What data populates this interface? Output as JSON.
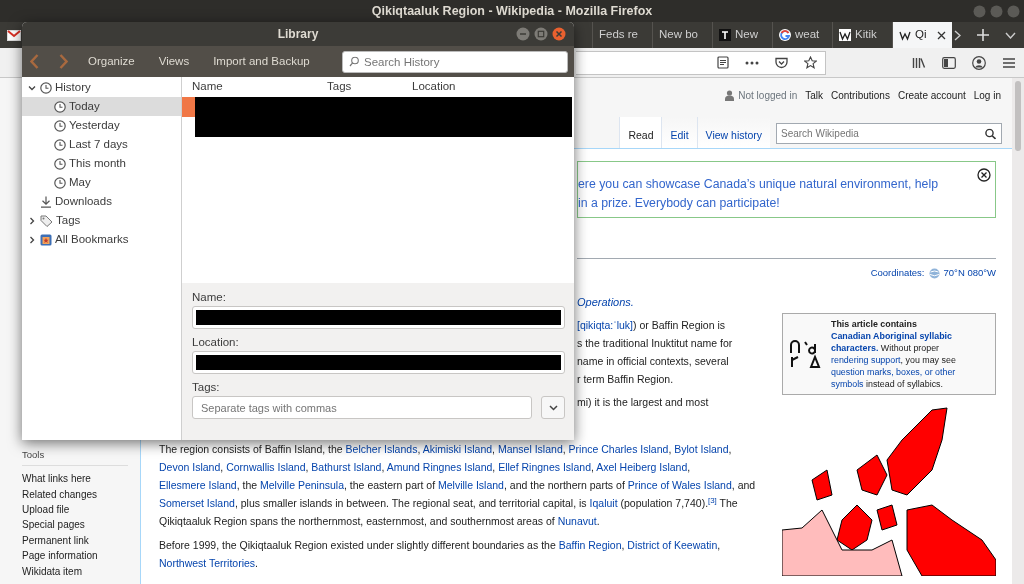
{
  "firefox": {
    "title": "Qikiqtaaluk Region - Wikipedia - Mozilla Firefox",
    "tabs": [
      {
        "label": "Feds re",
        "kind": "none",
        "selected": false
      },
      {
        "label": "New bo",
        "kind": "none",
        "selected": false
      },
      {
        "label": "New",
        "kind": "dark",
        "selected": false
      },
      {
        "label": "weat",
        "kind": "google",
        "selected": false
      },
      {
        "label": "Kitik",
        "kind": "wiki",
        "selected": false
      },
      {
        "label": "Qi",
        "kind": "wiki",
        "selected": true
      }
    ]
  },
  "wiki": {
    "user_links": [
      {
        "text": "Not logged in",
        "kind": "plain"
      },
      {
        "text": "Talk",
        "kind": "link"
      },
      {
        "text": "Contributions",
        "kind": "link"
      },
      {
        "text": "Create account",
        "kind": "link"
      },
      {
        "text": "Log in",
        "kind": "link"
      }
    ],
    "views": [
      {
        "label": "Read",
        "selected": true
      },
      {
        "label": "Edit",
        "selected": false
      },
      {
        "label": "View history",
        "selected": false
      }
    ],
    "search": {
      "placeholder": "Search Wikipedia"
    },
    "banner_lines": [
      "ere you can showcase Canada’s unique natural environment, help",
      "in a prize. Everybody can participate!"
    ],
    "coordinates": {
      "label": "Coordinates:",
      "value": "70°N 080°W"
    },
    "hatnote": "Operations.",
    "intro_lines": [
      [
        {
          "text": "[qikiqta:ˈluk]",
          "kind": "link"
        },
        {
          "text": ") or Baffin Region is",
          "kind": "text"
        }
      ],
      [
        {
          "text": "s the traditional Inuktitut name for",
          "kind": "text"
        }
      ],
      [
        {
          "text": "name in official contexts, several",
          "kind": "text"
        }
      ],
      [
        {
          "text": "r term Baffin Region.",
          "kind": "text"
        }
      ]
    ],
    "second_line": "mi) it is the largest and most",
    "notice": [
      [
        {
          "text": "This article contains",
          "kind": "bold"
        }
      ],
      [
        {
          "text": "Canadian Aboriginal syllabic",
          "kind": "bold-link"
        }
      ],
      [
        {
          "text": "characters.",
          "kind": "bold-link"
        },
        {
          "text": " Without proper",
          "kind": "text"
        }
      ],
      [
        {
          "text": "rendering support",
          "kind": "link"
        },
        {
          "text": ", you may see",
          "kind": "text"
        }
      ],
      [
        {
          "text": "question marks, boxes, or other",
          "kind": "link"
        }
      ],
      [
        {
          "text": "symbols",
          "kind": "link"
        },
        {
          "text": " instead of syllabics.",
          "kind": "text"
        }
      ]
    ],
    "paragraphs": [
      [
        {
          "text": "The region consists of Baffin Island, the ",
          "kind": "text"
        },
        {
          "text": "Belcher Islands",
          "kind": "link"
        },
        {
          "text": ", ",
          "kind": "text"
        },
        {
          "text": "Akimiski Island",
          "kind": "link"
        },
        {
          "text": ", ",
          "kind": "text"
        },
        {
          "text": "Mansel Island",
          "kind": "link"
        },
        {
          "text": ", ",
          "kind": "text"
        },
        {
          "text": "Prince Charles Island",
          "kind": "link"
        },
        {
          "text": ", ",
          "kind": "text"
        },
        {
          "text": "Bylot Island",
          "kind": "link"
        },
        {
          "text": ", ",
          "kind": "text"
        },
        {
          "text": "Devon Island",
          "kind": "link"
        },
        {
          "text": ", ",
          "kind": "text"
        },
        {
          "text": "Cornwallis Island",
          "kind": "link"
        },
        {
          "text": ", ",
          "kind": "text"
        },
        {
          "text": "Bathurst Island",
          "kind": "link"
        },
        {
          "text": ", ",
          "kind": "text"
        },
        {
          "text": "Amund Ringnes Island",
          "kind": "link"
        },
        {
          "text": ", ",
          "kind": "text"
        },
        {
          "text": "Ellef Ringnes Island",
          "kind": "link"
        },
        {
          "text": ", ",
          "kind": "text"
        },
        {
          "text": "Axel Heiberg Island",
          "kind": "link"
        },
        {
          "text": ", ",
          "kind": "text"
        },
        {
          "text": "Ellesmere Island",
          "kind": "link"
        },
        {
          "text": ", the ",
          "kind": "text"
        },
        {
          "text": "Melville Peninsula",
          "kind": "link"
        },
        {
          "text": ", the eastern part of ",
          "kind": "text"
        },
        {
          "text": "Melville Island",
          "kind": "link"
        },
        {
          "text": ", and the northern parts of ",
          "kind": "text"
        },
        {
          "text": "Prince of Wales Island",
          "kind": "link"
        },
        {
          "text": ", and ",
          "kind": "text"
        },
        {
          "text": "Somerset Island",
          "kind": "link"
        },
        {
          "text": ", plus smaller islands in between. The regional seat, and territorial capital, is ",
          "kind": "text"
        },
        {
          "text": "Iqaluit",
          "kind": "link"
        },
        {
          "text": " (population 7,740).",
          "kind": "text"
        },
        {
          "text": "[3]",
          "kind": "ref"
        },
        {
          "text": " The Qikiqtaaluk Region spans the northernmost, easternmost, and southernmost areas of ",
          "kind": "text"
        },
        {
          "text": "Nunavut",
          "kind": "link"
        },
        {
          "text": ".",
          "kind": "text"
        }
      ],
      [
        {
          "text": "Before 1999, the Qikiqtaaluk Region existed under slightly different boundaries as the ",
          "kind": "text"
        },
        {
          "text": "Baffin Region",
          "kind": "link"
        },
        {
          "text": ", ",
          "kind": "text"
        },
        {
          "text": "District of Keewatin",
          "kind": "link"
        },
        {
          "text": ", ",
          "kind": "text"
        },
        {
          "text": "Northwest Territories",
          "kind": "link"
        },
        {
          "text": ".",
          "kind": "text"
        }
      ]
    ],
    "sidebar": {
      "heading": "Tools",
      "links": [
        "What links here",
        "Related changes",
        "Upload file",
        "Special pages",
        "Permanent link",
        "Page information",
        "Wikidata item"
      ]
    }
  },
  "library": {
    "title": "Library",
    "menus": [
      "Organize",
      "Views",
      "Import and Backup"
    ],
    "search": {
      "placeholder": "Search History"
    },
    "tree": [
      {
        "label": "History",
        "kind": "clock",
        "expanded": true,
        "selected": false,
        "children": [
          {
            "label": "Today",
            "kind": "clock",
            "selected": true
          },
          {
            "label": "Yesterday",
            "kind": "clock",
            "selected": false
          },
          {
            "label": "Last 7 days",
            "kind": "clock",
            "selected": false
          },
          {
            "label": "This month",
            "kind": "clock",
            "selected": false
          },
          {
            "label": "May",
            "kind": "clock",
            "selected": false
          }
        ]
      },
      {
        "label": "Downloads",
        "kind": "download",
        "selected": false
      },
      {
        "label": "Tags",
        "kind": "tag",
        "expanded": false,
        "selected": false
      },
      {
        "label": "All Bookmarks",
        "kind": "bookmarks",
        "expanded": false,
        "selected": false
      }
    ],
    "columns": [
      "Name",
      "Tags",
      "Location"
    ],
    "rows": [
      {
        "selected": true
      }
    ],
    "fields": [
      {
        "label": "Name:",
        "kind": "redacted"
      },
      {
        "label": "Location:",
        "kind": "redacted"
      },
      {
        "label": "Tags:",
        "kind": "input",
        "placeholder": "Separate tags with commas"
      }
    ]
  }
}
